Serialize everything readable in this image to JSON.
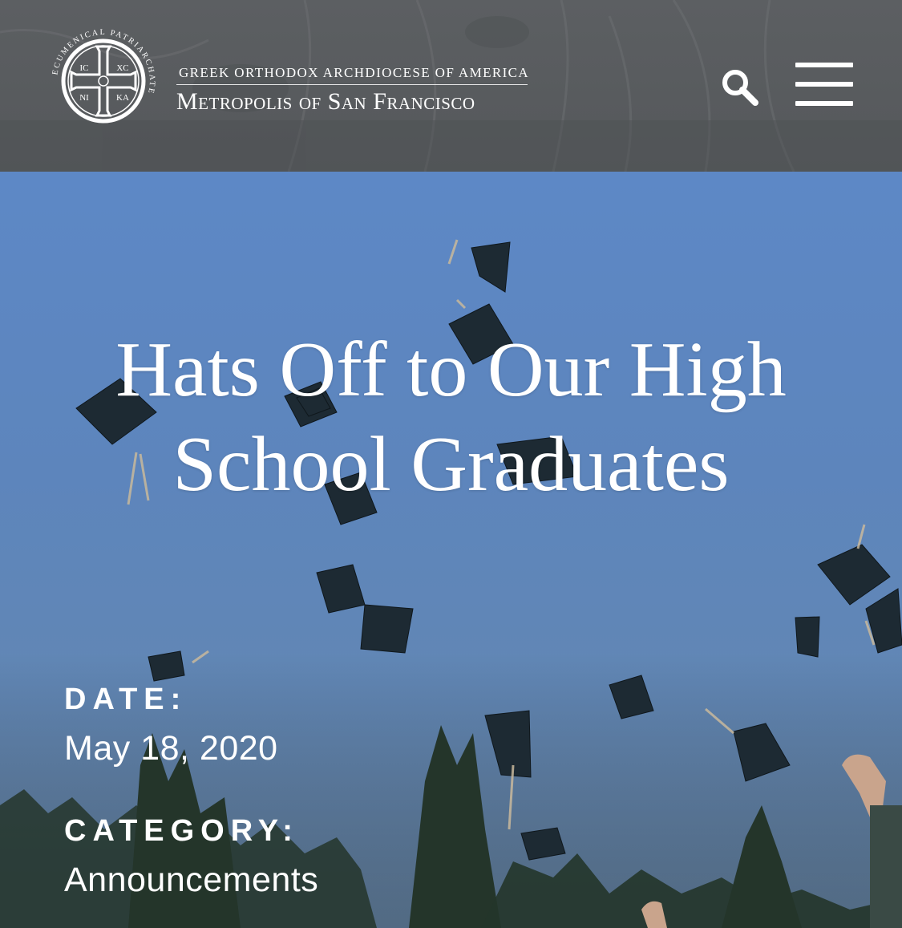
{
  "header": {
    "org_top": "Greek Orthodox Archdiocese of America",
    "org_main": "Metropolis of San Francisco",
    "logo": {
      "ring_text": "ECUMENICAL PATRIARCHATE",
      "q1": "IC",
      "q2": "XC",
      "q3": "NI",
      "q4": "KA"
    },
    "search_icon": "search-icon",
    "menu_icon": "hamburger-menu-icon"
  },
  "article": {
    "title": "Hats Off to Our High School Graduates",
    "date_label": "DATE:",
    "date_value": "May 18, 2020",
    "category_label": "CATEGORY:",
    "category_value": "Announcements"
  },
  "colors": {
    "header_bg": "#585b5e",
    "sky": "#5d86c0",
    "text": "#ffffff"
  }
}
